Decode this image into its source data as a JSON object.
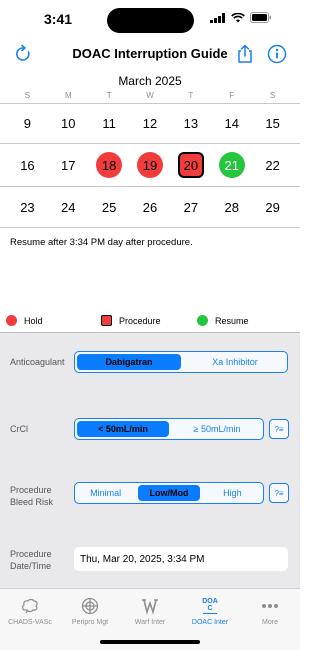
{
  "status_bar": {
    "time": "3:41"
  },
  "nav": {
    "title": "DOAC Interruption Guide"
  },
  "calendar": {
    "month": "March 2025",
    "weekdays": [
      "S",
      "M",
      "T",
      "W",
      "T",
      "F",
      "S"
    ],
    "weeks": [
      [
        {
          "day": "9",
          "state": "none"
        },
        {
          "day": "10",
          "state": "none"
        },
        {
          "day": "11",
          "state": "none"
        },
        {
          "day": "12",
          "state": "none"
        },
        {
          "day": "13",
          "state": "none"
        },
        {
          "day": "14",
          "state": "none"
        },
        {
          "day": "15",
          "state": "none"
        }
      ],
      [
        {
          "day": "16",
          "state": "none"
        },
        {
          "day": "17",
          "state": "none"
        },
        {
          "day": "18",
          "state": "hold"
        },
        {
          "day": "19",
          "state": "hold"
        },
        {
          "day": "20",
          "state": "procedure"
        },
        {
          "day": "21",
          "state": "resume"
        },
        {
          "day": "22",
          "state": "none"
        }
      ],
      [
        {
          "day": "23",
          "state": "none"
        },
        {
          "day": "24",
          "state": "none"
        },
        {
          "day": "25",
          "state": "none"
        },
        {
          "day": "26",
          "state": "none"
        },
        {
          "day": "27",
          "state": "none"
        },
        {
          "day": "28",
          "state": "none"
        },
        {
          "day": "29",
          "state": "none"
        }
      ]
    ],
    "note": "Resume after 3:34 PM day after procedure."
  },
  "legend": {
    "hold": "Hold",
    "procedure": "Procedure",
    "resume": "Resume",
    "hold_color": "#f23b3b",
    "resume_color": "#26c53e"
  },
  "form": {
    "anticoagulant": {
      "label": "Anticoagulant",
      "options": [
        "Dabigatran",
        "Xa Inhibitor"
      ],
      "selected": "Dabigatran"
    },
    "crcl": {
      "label": "CrCl",
      "options": [
        "< 50mL/min",
        "≥ 50mL/min"
      ],
      "selected": "< 50mL/min",
      "help": "?≡"
    },
    "bleed_risk": {
      "label_line1": "Procedure",
      "label_line2": "Bleed Risk",
      "options": [
        "Minimal",
        "Low/Mod",
        "High"
      ],
      "selected": "Low/Mod",
      "help": "?≡"
    },
    "procedure_datetime": {
      "label_line1": "Procedure",
      "label_line2": "Date/Time",
      "value": "Thu, Mar 20, 2025, 3:34 PM"
    }
  },
  "tabbar": {
    "tabs": [
      {
        "label": "CHADS-VASc",
        "icon": "brain-icon"
      },
      {
        "label": "Peripro Mgt",
        "icon": "crosshair-icon"
      },
      {
        "label": "Warf Inter",
        "icon": "w-icon"
      },
      {
        "label": "DOAC Inter",
        "icon": "doac-icon"
      },
      {
        "label": "More",
        "icon": "more-icon"
      }
    ],
    "active": "DOAC Inter",
    "doac_icon_text_top": "DOA",
    "doac_icon_text_bottom": "C"
  },
  "colors": {
    "accent": "#1a7ff0"
  }
}
